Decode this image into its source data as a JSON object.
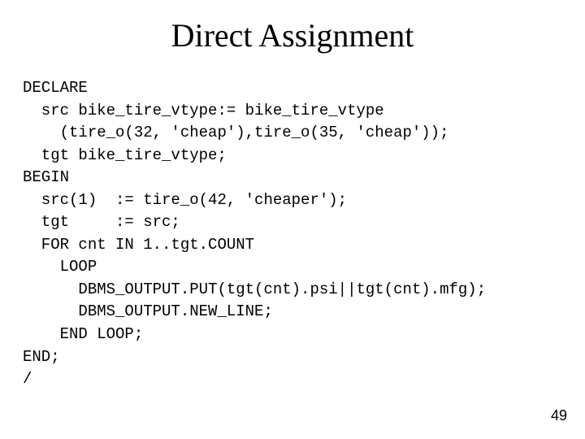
{
  "title": "Direct Assignment",
  "code_lines": [
    "DECLARE",
    "  src bike_tire_vtype:= bike_tire_vtype",
    "    (tire_o(32, 'cheap'),tire_o(35, 'cheap'));",
    "  tgt bike_tire_vtype;",
    "BEGIN",
    "  src(1)  := tire_o(42, 'cheaper');",
    "  tgt     := src;",
    "  FOR cnt IN 1..tgt.COUNT",
    "    LOOP",
    "      DBMS_OUTPUT.PUT(tgt(cnt).psi||tgt(cnt).mfg);",
    "      DBMS_OUTPUT.NEW_LINE;",
    "    END LOOP;",
    "END;",
    "/"
  ],
  "page_number": "49"
}
